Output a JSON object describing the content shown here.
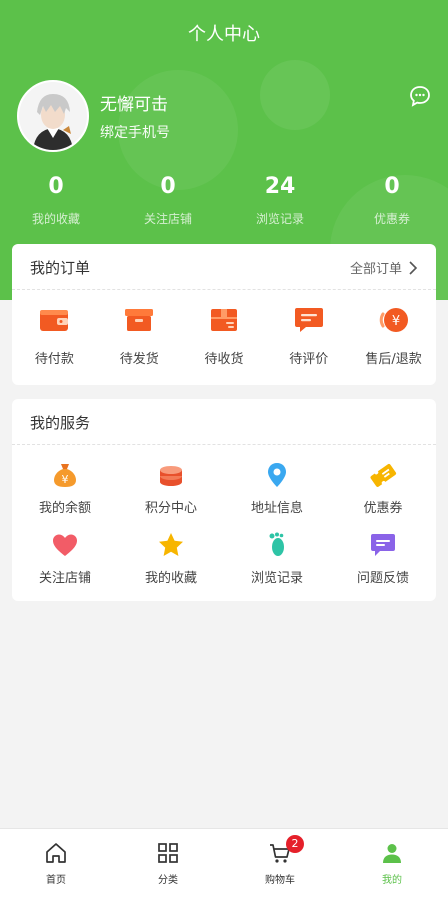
{
  "header": {
    "title": "个人中心",
    "username": "无懈可击",
    "bind_phone": "绑定手机号"
  },
  "stats": [
    {
      "value": "0",
      "label": "我的收藏"
    },
    {
      "value": "0",
      "label": "关注店铺"
    },
    {
      "value": "24",
      "label": "浏览记录"
    },
    {
      "value": "0",
      "label": "优惠券"
    }
  ],
  "orders": {
    "title": "我的订单",
    "all_label": "全部订单",
    "items": [
      {
        "label": "待付款",
        "icon": "wallet-icon"
      },
      {
        "label": "待发货",
        "icon": "box-icon"
      },
      {
        "label": "待收货",
        "icon": "package-icon"
      },
      {
        "label": "待评价",
        "icon": "comment-icon"
      },
      {
        "label": "售后/退款",
        "icon": "refund-icon"
      }
    ]
  },
  "services": {
    "title": "我的服务",
    "items": [
      {
        "label": "我的余额",
        "icon": "money-bag-icon"
      },
      {
        "label": "积分中心",
        "icon": "coins-icon"
      },
      {
        "label": "地址信息",
        "icon": "location-pin-icon"
      },
      {
        "label": "优惠券",
        "icon": "coupon-icon"
      },
      {
        "label": "关注店铺",
        "icon": "heart-icon"
      },
      {
        "label": "我的收藏",
        "icon": "star-icon"
      },
      {
        "label": "浏览记录",
        "icon": "footprint-icon"
      },
      {
        "label": "问题反馈",
        "icon": "feedback-icon"
      }
    ]
  },
  "tabbar": {
    "items": [
      {
        "label": "首页",
        "icon": "home-icon"
      },
      {
        "label": "分类",
        "icon": "grid-icon"
      },
      {
        "label": "购物车",
        "icon": "cart-icon",
        "badge": "2"
      },
      {
        "label": "我的",
        "icon": "user-icon",
        "active": true
      }
    ]
  },
  "colors": {
    "brand_green": "#5cc14a",
    "order_orange": "#f25a22",
    "badge_red": "#e5202a"
  }
}
